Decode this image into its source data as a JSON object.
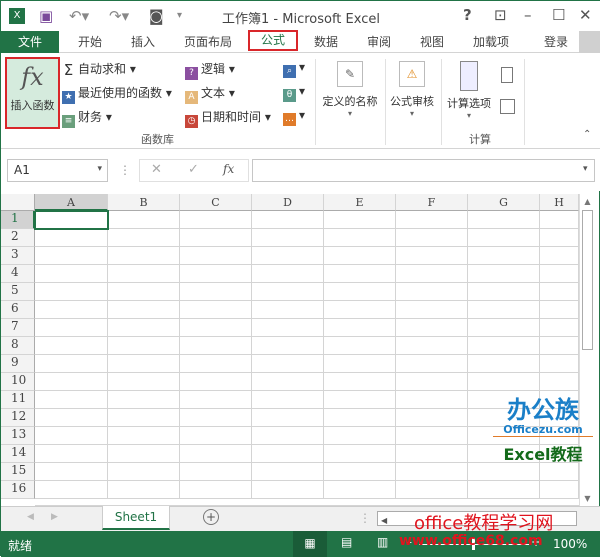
{
  "title": "工作簿1 - Microsoft Excel",
  "window_buttons": {
    "help": "?",
    "restore_ribbon": "⊡",
    "minimize": "–",
    "maximize": "☐",
    "close": "✕"
  },
  "tabs": [
    "文件",
    "开始",
    "插入",
    "页面布局",
    "公式",
    "数据",
    "审阅",
    "视图",
    "加载项"
  ],
  "active_tab": "公式",
  "login": "登录",
  "ribbon": {
    "insert_function": {
      "icon": "fx",
      "label": "插入函数"
    },
    "autosum": "自动求和",
    "recent": "最近使用的函数",
    "financial": "财务",
    "logical": "逻辑",
    "text": "文本",
    "datetime": "日期和时间",
    "group_library": "函数库",
    "defined_names": "定义的名称",
    "formula_auditing": "公式审核",
    "calc_options": "计算选项",
    "group_calc": "计算"
  },
  "formula_bar": {
    "name_box": "A1",
    "cancel": "✕",
    "enter": "✓",
    "fx": "fx",
    "value": ""
  },
  "columns": [
    "A",
    "B",
    "C",
    "D",
    "E",
    "F",
    "G",
    "H"
  ],
  "rows": [
    "1",
    "2",
    "3",
    "4",
    "5",
    "6",
    "7",
    "8",
    "9",
    "10",
    "11",
    "12",
    "13",
    "14",
    "15",
    "16"
  ],
  "sheet_tab": "Sheet1",
  "status": {
    "ready": "就绪",
    "zoom": "100%"
  },
  "watermarks": {
    "logo_text": "办公族",
    "logo_url": "Officezu.com",
    "logo_sub": "Excel教程",
    "site_name": "office教程学习网",
    "site_url": "www.office68.com"
  },
  "colors": {
    "accent": "#217346",
    "highlight_box": "#d9262a"
  }
}
